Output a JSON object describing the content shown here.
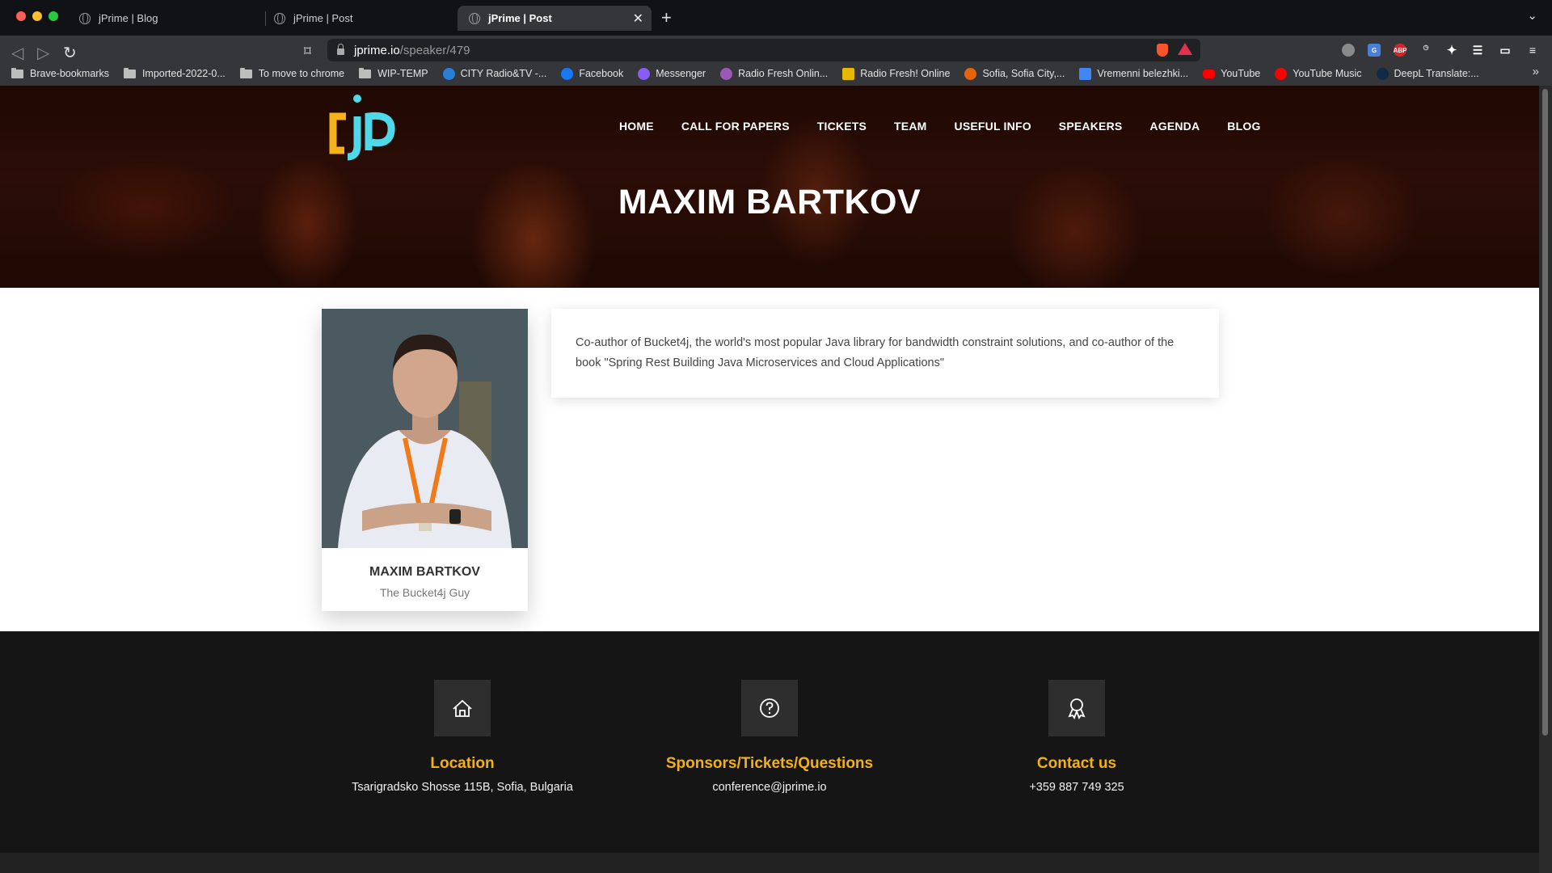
{
  "browser": {
    "tabs": [
      {
        "title": "jPrime | Blog",
        "active": false
      },
      {
        "title": "jPrime | Post",
        "active": false
      },
      {
        "title": "jPrime | Post",
        "active": true
      }
    ],
    "url_host": "jprime.io",
    "url_path": "/speaker/479",
    "bookmarks": [
      {
        "label": "Brave-bookmarks",
        "icon": "folder-icon"
      },
      {
        "label": "Imported-2022-0...",
        "icon": "folder-icon"
      },
      {
        "label": "To move to chrome",
        "icon": "folder-icon"
      },
      {
        "label": "WIP-TEMP",
        "icon": "folder-icon"
      },
      {
        "label": "CITY Radio&TV -...",
        "icon": "city-radio-icon",
        "color": "#2a7fd4"
      },
      {
        "label": "Facebook",
        "icon": "facebook-icon",
        "color": "#1877f2"
      },
      {
        "label": "Messenger",
        "icon": "messenger-icon",
        "color": "#8a5cf6"
      },
      {
        "label": "Radio Fresh Onlin...",
        "icon": "radio-fresh-icon",
        "color": "#9b59b6"
      },
      {
        "label": "Radio Fresh! Online",
        "icon": "radio-fresh-online-icon",
        "color": "#e6b800"
      },
      {
        "label": "Sofia, Sofia City,...",
        "icon": "weather-icon",
        "color": "#e8620c"
      },
      {
        "label": "Vremenni belezhki...",
        "icon": "docs-icon",
        "color": "#4285f4"
      },
      {
        "label": "YouTube",
        "icon": "youtube-icon",
        "color": "#ff0000"
      },
      {
        "label": "YouTube Music",
        "icon": "youtube-music-icon",
        "color": "#ff0000"
      },
      {
        "label": "DeepL Translate:...",
        "icon": "deepl-icon",
        "color": "#0f2b46"
      }
    ],
    "bookmarks_more": "»"
  },
  "site": {
    "nav": [
      "HOME",
      "CALL FOR PAPERS",
      "TICKETS",
      "TEAM",
      "USEFUL INFO",
      "SPEAKERS",
      "AGENDA",
      "BLOG"
    ],
    "hero_title": "MAXIM BARTKOV",
    "accent_color": "#f2b215",
    "logo_colors": {
      "yellow": "#f5b21a",
      "cyan": "#4fd8e8"
    }
  },
  "speaker": {
    "name": "MAXIM BARTKOV",
    "role": "The Bucket4j Guy",
    "bio": "Co-author of Bucket4j, the world's most popular Java library for bandwidth constraint solutions, and co-author of the book \"Spring Rest Building Java Microservices and Cloud Applications\""
  },
  "footer": {
    "columns": [
      {
        "icon": "home-icon",
        "title": "Location",
        "text": "Tsarigradsko Shosse 115B, Sofia, Bulgaria"
      },
      {
        "icon": "question-icon",
        "title": "Sponsors/Tickets/Questions",
        "text": "conference@jprime.io"
      },
      {
        "icon": "award-icon",
        "title": "Contact us",
        "text": "+359 887 749 325"
      }
    ]
  }
}
